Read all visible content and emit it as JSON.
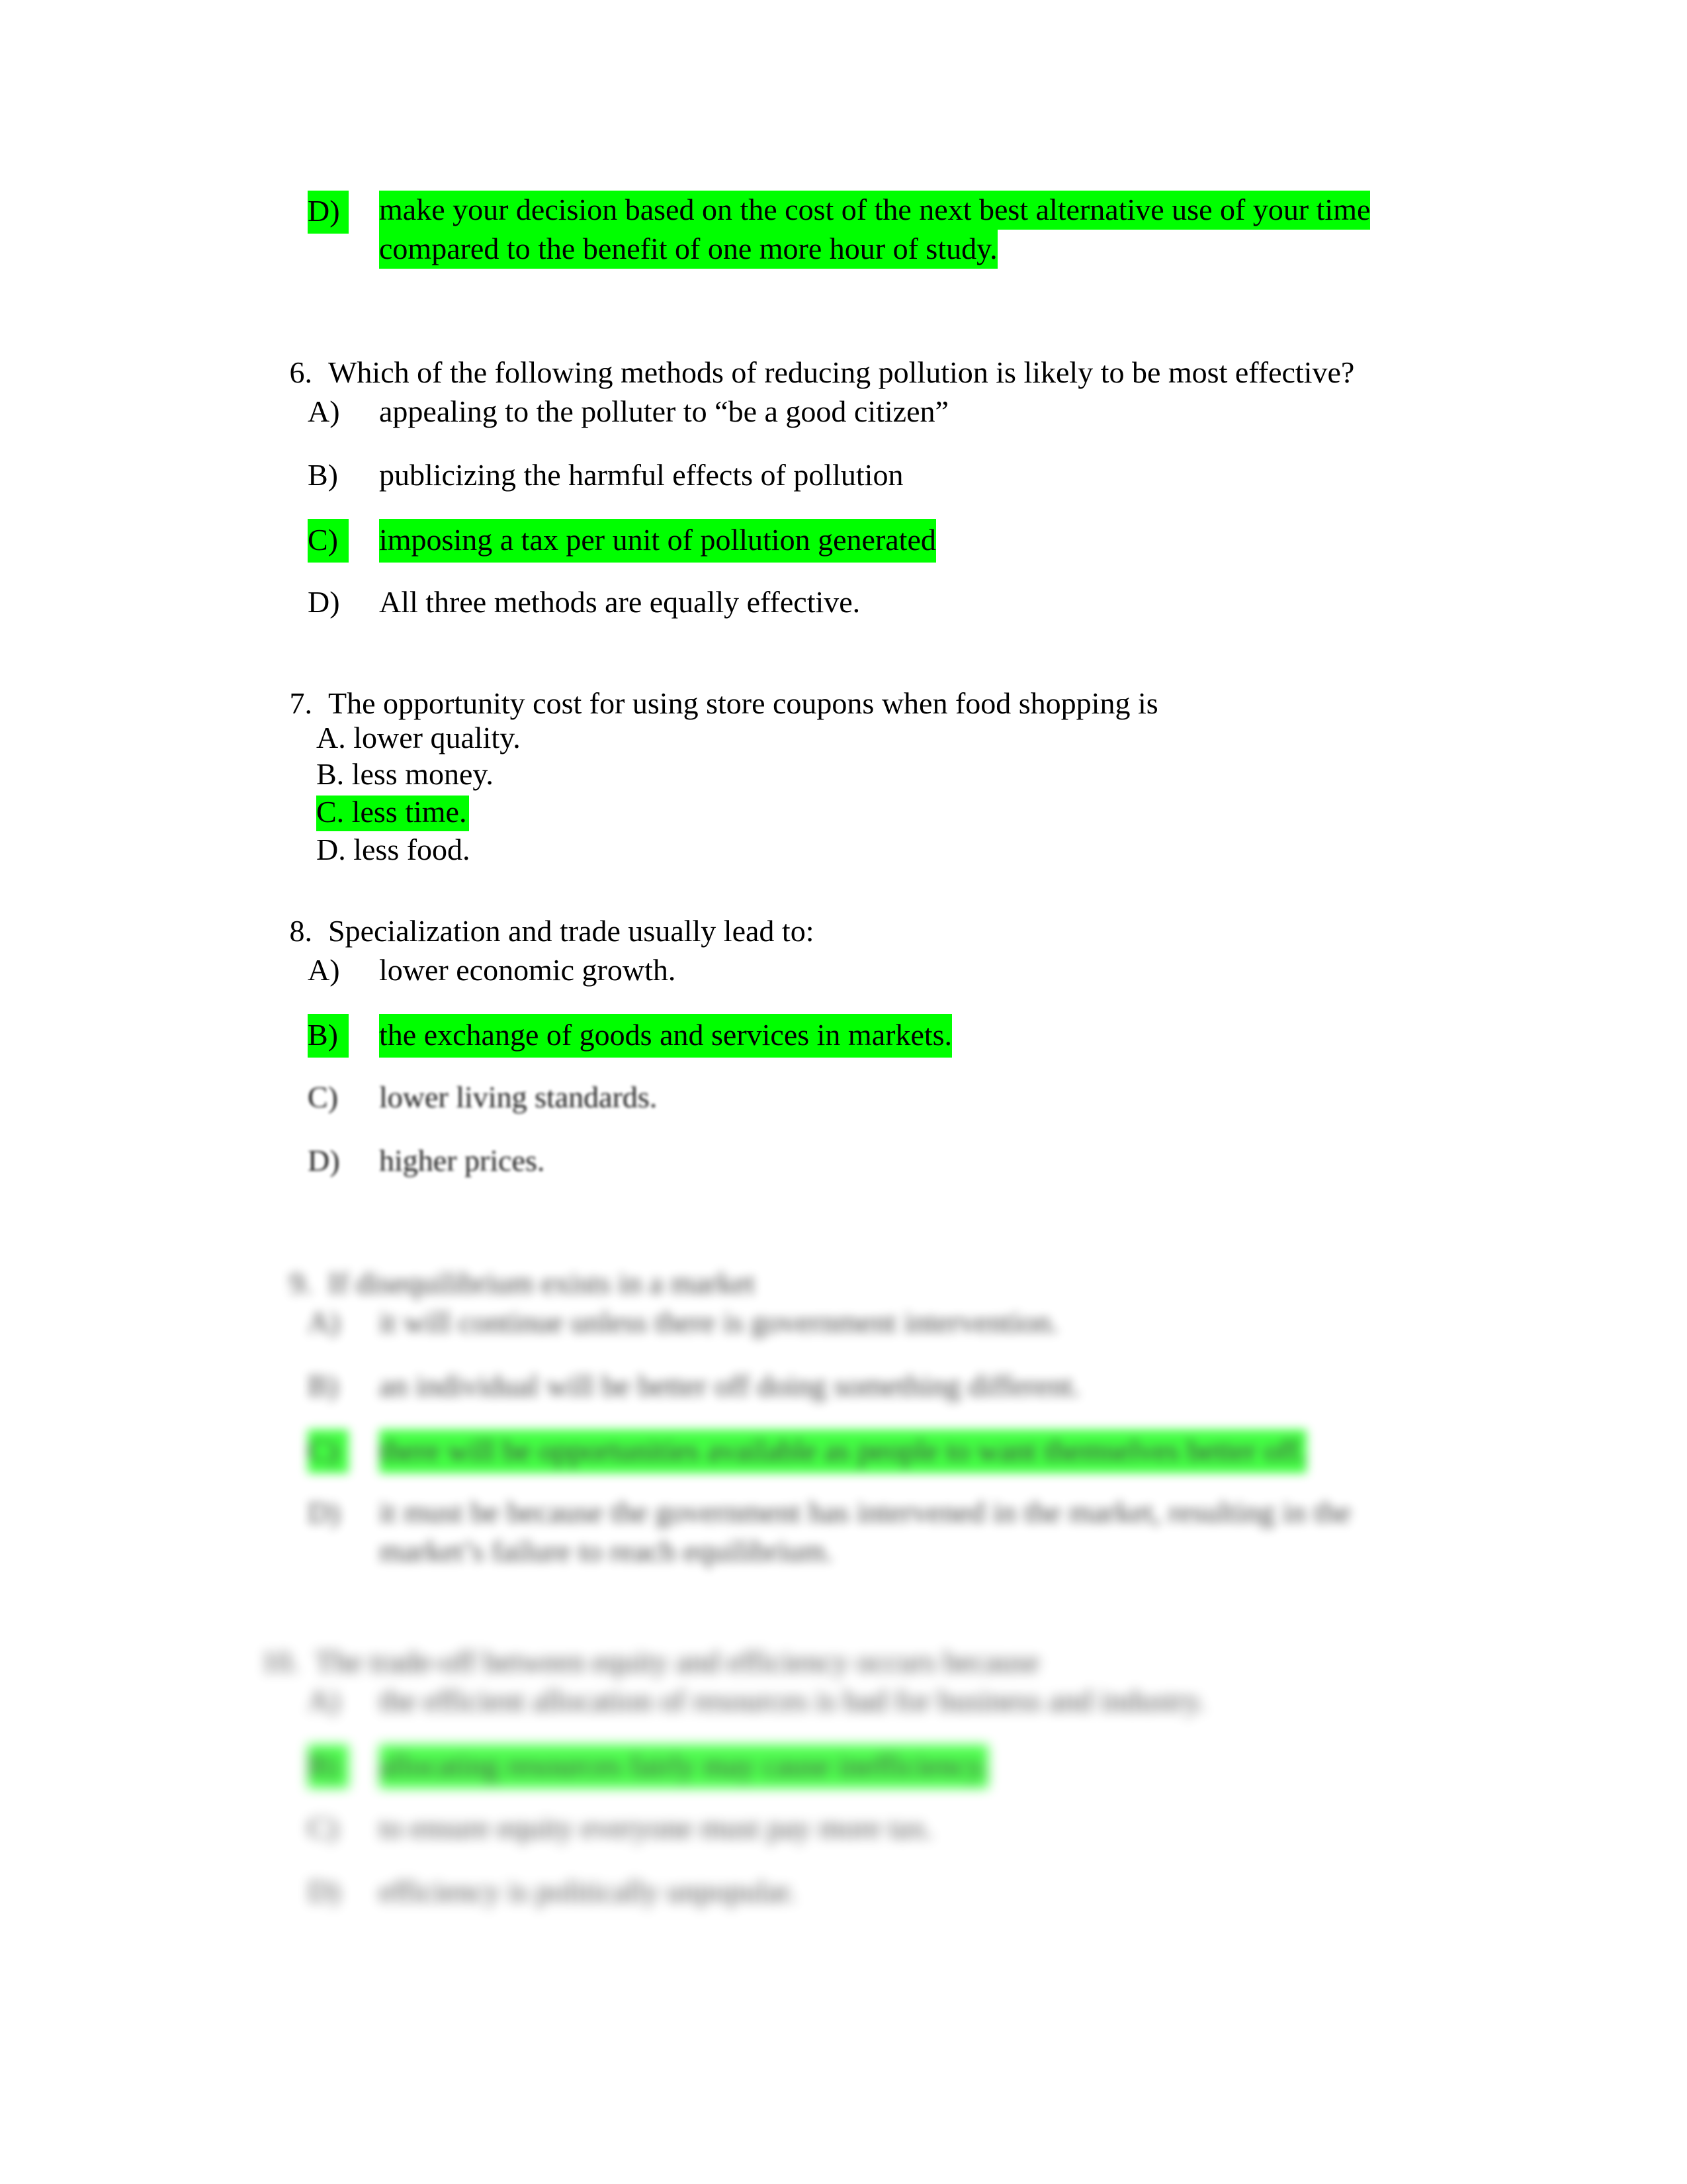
{
  "document": {
    "type": "multiple-choice quiz",
    "page_background": "#ffffff",
    "highlight_color": "#00ff00",
    "text_color": "#000000"
  },
  "carryover_option": {
    "letter": "D)",
    "text": "make your decision based on the cost of the next best alternative use of your time compared to the benefit of one more hour of study.",
    "highlighted": true
  },
  "questions": [
    {
      "number": "6.",
      "stem": "Which of the following methods of reducing pollution is likely to be most effective?",
      "style": "paren",
      "options": [
        {
          "letter": "A)",
          "text": "appealing to the polluter to “be a good citizen”",
          "highlighted": false
        },
        {
          "letter": "B)",
          "text": "publicizing the harmful effects of pollution",
          "highlighted": false
        },
        {
          "letter": "C)",
          "text": "imposing a tax per unit of pollution generated",
          "highlighted": true
        },
        {
          "letter": "D)",
          "text": "All three methods are equally effective.",
          "highlighted": false
        }
      ]
    },
    {
      "number": "7.",
      "stem": "The opportunity cost for using store coupons when food shopping is",
      "style": "plain",
      "options": [
        {
          "letter": "A.",
          "text": "lower quality.",
          "highlighted": false
        },
        {
          "letter": "B.",
          "text": "less money.",
          "highlighted": false
        },
        {
          "letter": "C.",
          "text": "less time.",
          "highlighted": true
        },
        {
          "letter": "D.",
          "text": "less food.",
          "highlighted": false
        }
      ]
    },
    {
      "number": "8.",
      "stem": "Specialization and trade usually lead to:",
      "style": "paren",
      "options": [
        {
          "letter": "A)",
          "text": "lower economic growth.",
          "highlighted": false
        },
        {
          "letter": "B)",
          "text": "the exchange of goods and services in markets.",
          "highlighted": true
        },
        {
          "letter": "C)",
          "text": "lower living standards.",
          "highlighted": false
        },
        {
          "letter": "D)",
          "text": "higher prices.",
          "highlighted": false
        }
      ]
    },
    {
      "number": "9.",
      "stem": "If disequilibrium exists in a market",
      "style": "paren",
      "options": [
        {
          "letter": "A)",
          "text": "it will continue unless there is government intervention.",
          "highlighted": false
        },
        {
          "letter": "B)",
          "text": "an individual will be better off doing something different.",
          "highlighted": false
        },
        {
          "letter": "C)",
          "text": "there will be opportunities available as people to want themselves better off.",
          "highlighted": true
        },
        {
          "letter": "D)",
          "text": "it must be because the government has intervened in the market, resulting in the market’s failure to reach equilibrium.",
          "highlighted": false
        }
      ]
    },
    {
      "number": "10.",
      "stem": "The trade-off between equity and efficiency occurs because",
      "style": "paren",
      "options": [
        {
          "letter": "A)",
          "text": "the efficient allocation of resources is bad for business and industry.",
          "highlighted": false
        },
        {
          "letter": "B)",
          "text": "allocating resources fairly may cause inefficiency.",
          "highlighted": true
        },
        {
          "letter": "C)",
          "text": "to ensure equity everyone must pay more tax.",
          "highlighted": false
        },
        {
          "letter": "D)",
          "text": "efficiency is politically unpopular.",
          "highlighted": false
        }
      ]
    }
  ]
}
